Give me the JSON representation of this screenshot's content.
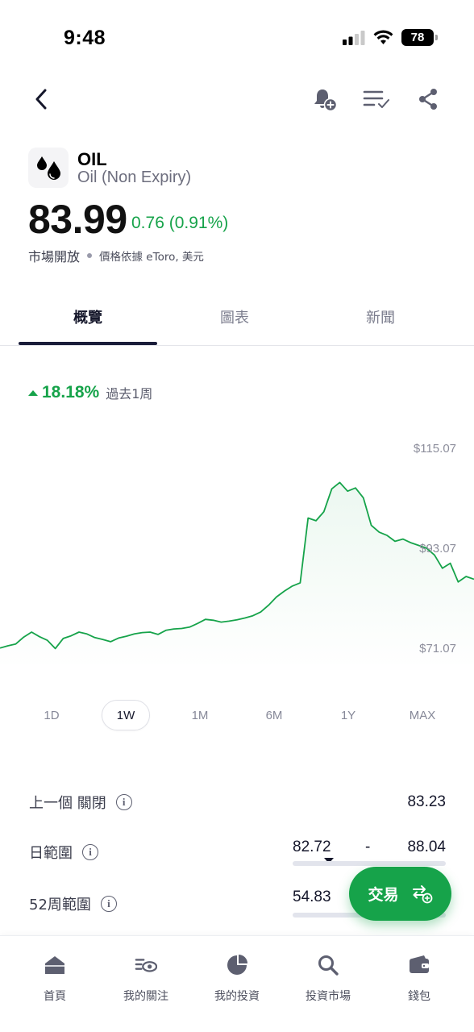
{
  "status_bar": {
    "time": "9:48",
    "battery": "78"
  },
  "instrument": {
    "symbol": "OIL",
    "name": "Oil (Non Expiry)",
    "price": "83.99",
    "change": "0.76 (0.91%)",
    "market_status": "市場開放",
    "price_source": "價格依據 eToro, 美元"
  },
  "tabs": [
    {
      "label": "概覽",
      "active": true
    },
    {
      "label": "圖表",
      "active": false
    },
    {
      "label": "新聞",
      "active": false
    }
  ],
  "performance": {
    "value": "18.18%",
    "label": "過去1周",
    "direction": "up"
  },
  "chart_data": {
    "type": "line",
    "color": "#16a34a",
    "y_labels": [
      "$115.07",
      "$93.07",
      "$71.07"
    ],
    "ylim": [
      71.07,
      115.07
    ],
    "x": [
      0,
      1,
      2,
      3,
      4,
      5,
      6,
      7,
      8,
      9,
      10,
      11,
      12,
      13,
      14,
      15,
      16,
      17,
      18,
      19,
      20,
      21,
      22,
      23,
      24,
      25,
      26,
      27,
      28,
      29,
      30,
      31,
      32,
      33,
      34,
      35,
      36,
      37,
      38,
      39,
      40,
      41,
      42,
      43,
      44,
      45,
      46,
      47,
      48,
      49,
      50,
      51,
      52,
      53,
      54,
      55,
      56,
      57,
      58,
      59,
      60
    ],
    "values": [
      71.1,
      71.6,
      72.0,
      73.5,
      74.6,
      73.6,
      72.8,
      71.0,
      73.2,
      73.8,
      74.6,
      74.2,
      73.4,
      73.0,
      72.5,
      73.3,
      73.7,
      74.2,
      74.5,
      74.6,
      74.1,
      75.0,
      75.3,
      75.4,
      75.7,
      76.5,
      77.4,
      77.2,
      76.8,
      77.0,
      77.3,
      77.7,
      78.2,
      79.0,
      80.5,
      82.3,
      83.6,
      84.7,
      85.4,
      99.6,
      99.0,
      101.0,
      106.0,
      107.4,
      105.5,
      106.2,
      104.0,
      98.0,
      96.5,
      95.8,
      94.5,
      95.0,
      94.2,
      93.6,
      93.0,
      91.5,
      88.6,
      89.7,
      85.6,
      86.8,
      86.2
    ]
  },
  "ranges": [
    "1D",
    "1W",
    "1M",
    "6M",
    "1Y",
    "MAX"
  ],
  "active_range": "1W",
  "stats": {
    "prev_close": {
      "label": "上一個 關閉",
      "value": "83.23"
    },
    "day_range": {
      "label": "日範圍",
      "low": "82.72",
      "sep": "-",
      "high": "88.04",
      "position": 0.05
    },
    "week52_range": {
      "label": "52周範圍",
      "low": "54.83"
    }
  },
  "trade_button": {
    "label": "交易"
  },
  "bottom_nav": [
    {
      "label": "首頁",
      "icon": "home-icon"
    },
    {
      "label": "我的關注",
      "icon": "watchlist-icon"
    },
    {
      "label": "我的投資",
      "icon": "portfolio-icon"
    },
    {
      "label": "投資市場",
      "icon": "search-icon"
    },
    {
      "label": "錢包",
      "icon": "wallet-icon"
    }
  ]
}
